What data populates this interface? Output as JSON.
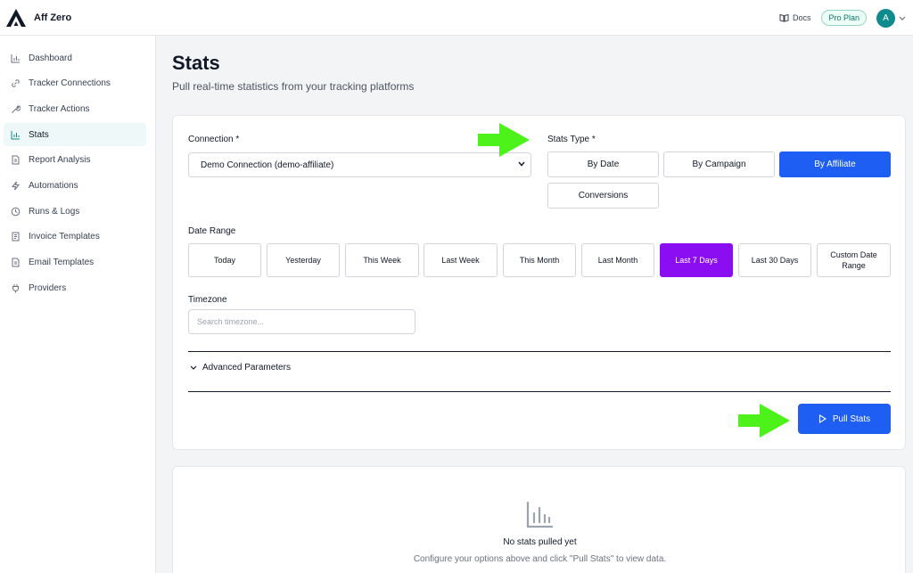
{
  "app": {
    "name": "Aff Zero"
  },
  "topbar": {
    "docs_label": "Docs",
    "plan_label": "Pro Plan",
    "avatar_initial": "A"
  },
  "sidebar": {
    "items": [
      {
        "label": "Dashboard",
        "icon": "bar-chart-icon"
      },
      {
        "label": "Tracker Connections",
        "icon": "link-icon"
      },
      {
        "label": "Tracker Actions",
        "icon": "wrench-icon"
      },
      {
        "label": "Stats",
        "icon": "bar-chart-icon",
        "active": true
      },
      {
        "label": "Report Analysis",
        "icon": "file-icon"
      },
      {
        "label": "Automations",
        "icon": "bolt-icon"
      },
      {
        "label": "Runs & Logs",
        "icon": "clock-icon"
      },
      {
        "label": "Invoice Templates",
        "icon": "receipt-icon"
      },
      {
        "label": "Email Templates",
        "icon": "file-icon"
      },
      {
        "label": "Providers",
        "icon": "plug-icon"
      }
    ]
  },
  "page": {
    "title": "Stats",
    "subtitle": "Pull real-time statistics from your tracking platforms"
  },
  "form": {
    "connection_label": "Connection *",
    "connection_value": "Demo Connection (demo-affiliate)",
    "stats_type_label": "Stats Type *",
    "stats_types": [
      "By Date",
      "By Campaign",
      "By Affiliate",
      "Conversions"
    ],
    "stats_type_selected": "By Affiliate",
    "date_range_label": "Date Range",
    "date_ranges": [
      "Today",
      "Yesterday",
      "This Week",
      "Last Week",
      "This Month",
      "Last Month",
      "Last 7 Days",
      "Last 30 Days",
      "Custom Date Range"
    ],
    "date_range_selected": "Last 7 Days",
    "timezone_label": "Timezone",
    "timezone_placeholder": "Search timezone...",
    "advanced_label": "Advanced Parameters",
    "pull_button": "Pull Stats"
  },
  "empty_state": {
    "title": "No stats pulled yet",
    "subtitle": "Configure your options above and click \"Pull Stats\" to view data."
  },
  "colors": {
    "primary": "#1e5ef3",
    "selected_date": "#8b0ef2",
    "arrow": "#4df21a",
    "avatar": "#0f8b8d"
  }
}
